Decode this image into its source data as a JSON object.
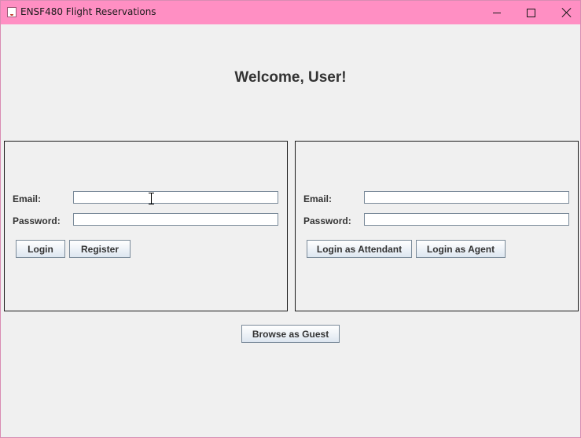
{
  "window": {
    "title": "ENSF480 Flight Reservations",
    "title_bar_color": "#ff8fc3"
  },
  "main": {
    "welcome_text": "Welcome, User!"
  },
  "login_panel": {
    "email_label": "Email:",
    "email_value": "",
    "password_label": "Password:",
    "password_value": "",
    "login_button": "Login",
    "register_button": "Register"
  },
  "staff_panel": {
    "email_label": "Email:",
    "email_value": "",
    "password_label": "Password:",
    "password_value": "",
    "attendant_button": "Login as Attendant",
    "agent_button": "Login as Agent"
  },
  "guest_button": "Browse as Guest",
  "icons": {
    "app": "java-app-icon",
    "minimize": "minimize-icon",
    "maximize": "maximize-icon",
    "close": "close-icon",
    "cursor": "text-cursor-icon"
  }
}
